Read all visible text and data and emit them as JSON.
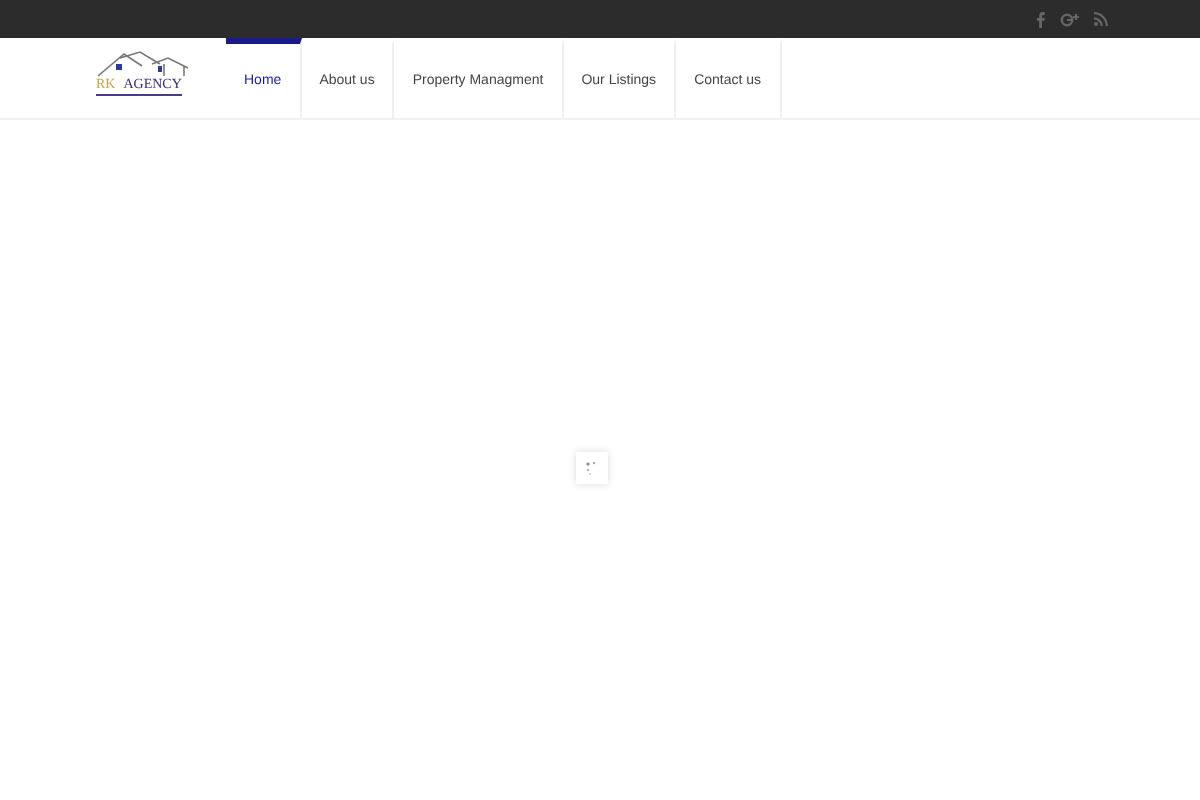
{
  "top_bar": {
    "social": [
      {
        "kind": "facebook"
      },
      {
        "kind": "googleplus"
      },
      {
        "kind": "rss"
      }
    ]
  },
  "logo": {
    "initials": "RK",
    "name": "AGENCY"
  },
  "nav": [
    {
      "label": "Home",
      "selected": true
    },
    {
      "label": "About us",
      "selected": false
    },
    {
      "label": "Property Managment",
      "selected": false
    },
    {
      "label": "Our Listings",
      "selected": false
    },
    {
      "label": "Contact us",
      "selected": false
    }
  ]
}
